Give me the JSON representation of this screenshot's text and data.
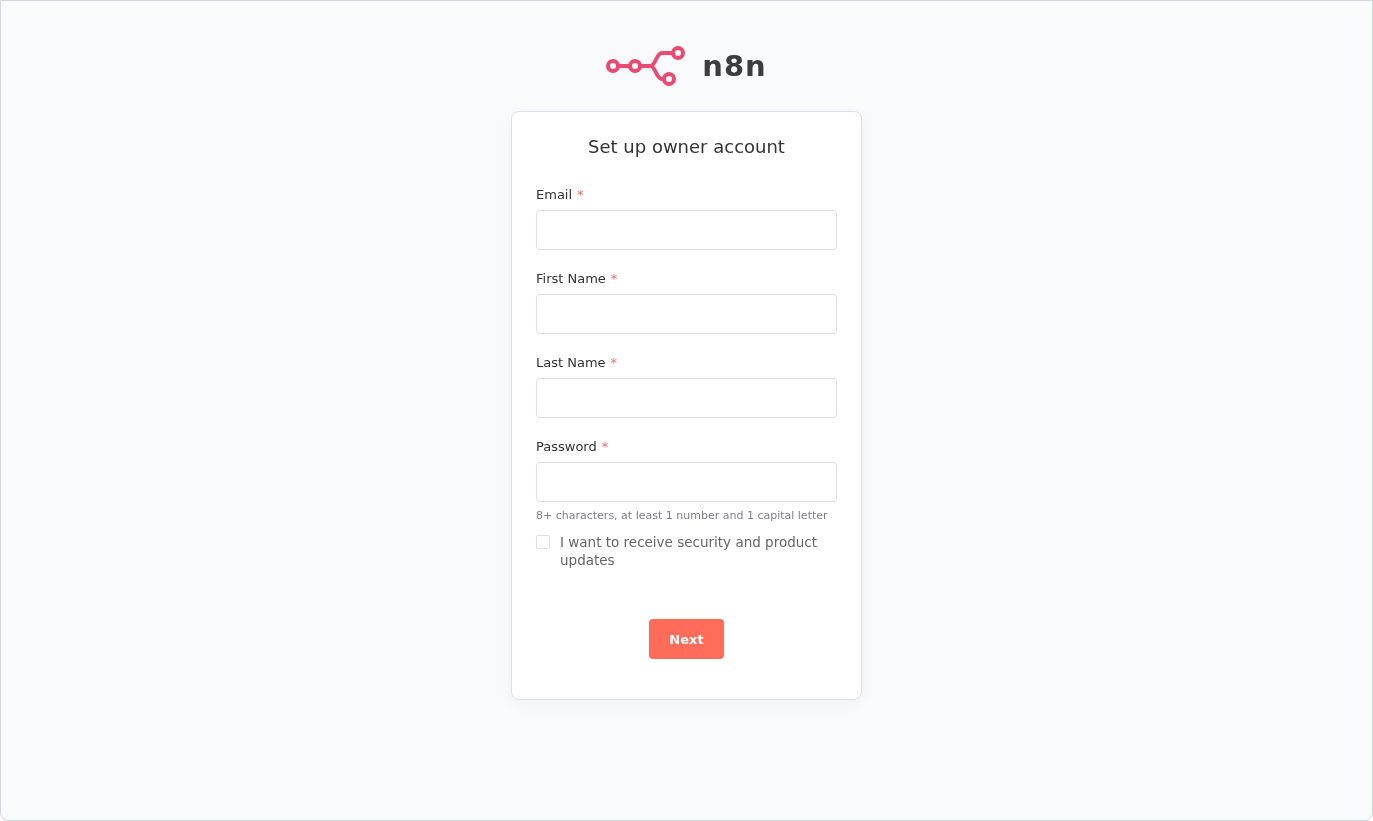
{
  "logo": {
    "wordmark": "n8n"
  },
  "form": {
    "title": "Set up owner account",
    "fields": [
      {
        "label": "Email",
        "required_mark": "*"
      },
      {
        "label": "First Name",
        "required_mark": "*"
      },
      {
        "label": "Last Name",
        "required_mark": "*"
      },
      {
        "label": "Password",
        "required_mark": "*",
        "hint": "8+ characters, at least 1 number and 1 capital letter"
      }
    ],
    "checkbox": {
      "label": "I want to receive security and product updates",
      "checked": false
    },
    "submit": {
      "label": "Next"
    }
  }
}
